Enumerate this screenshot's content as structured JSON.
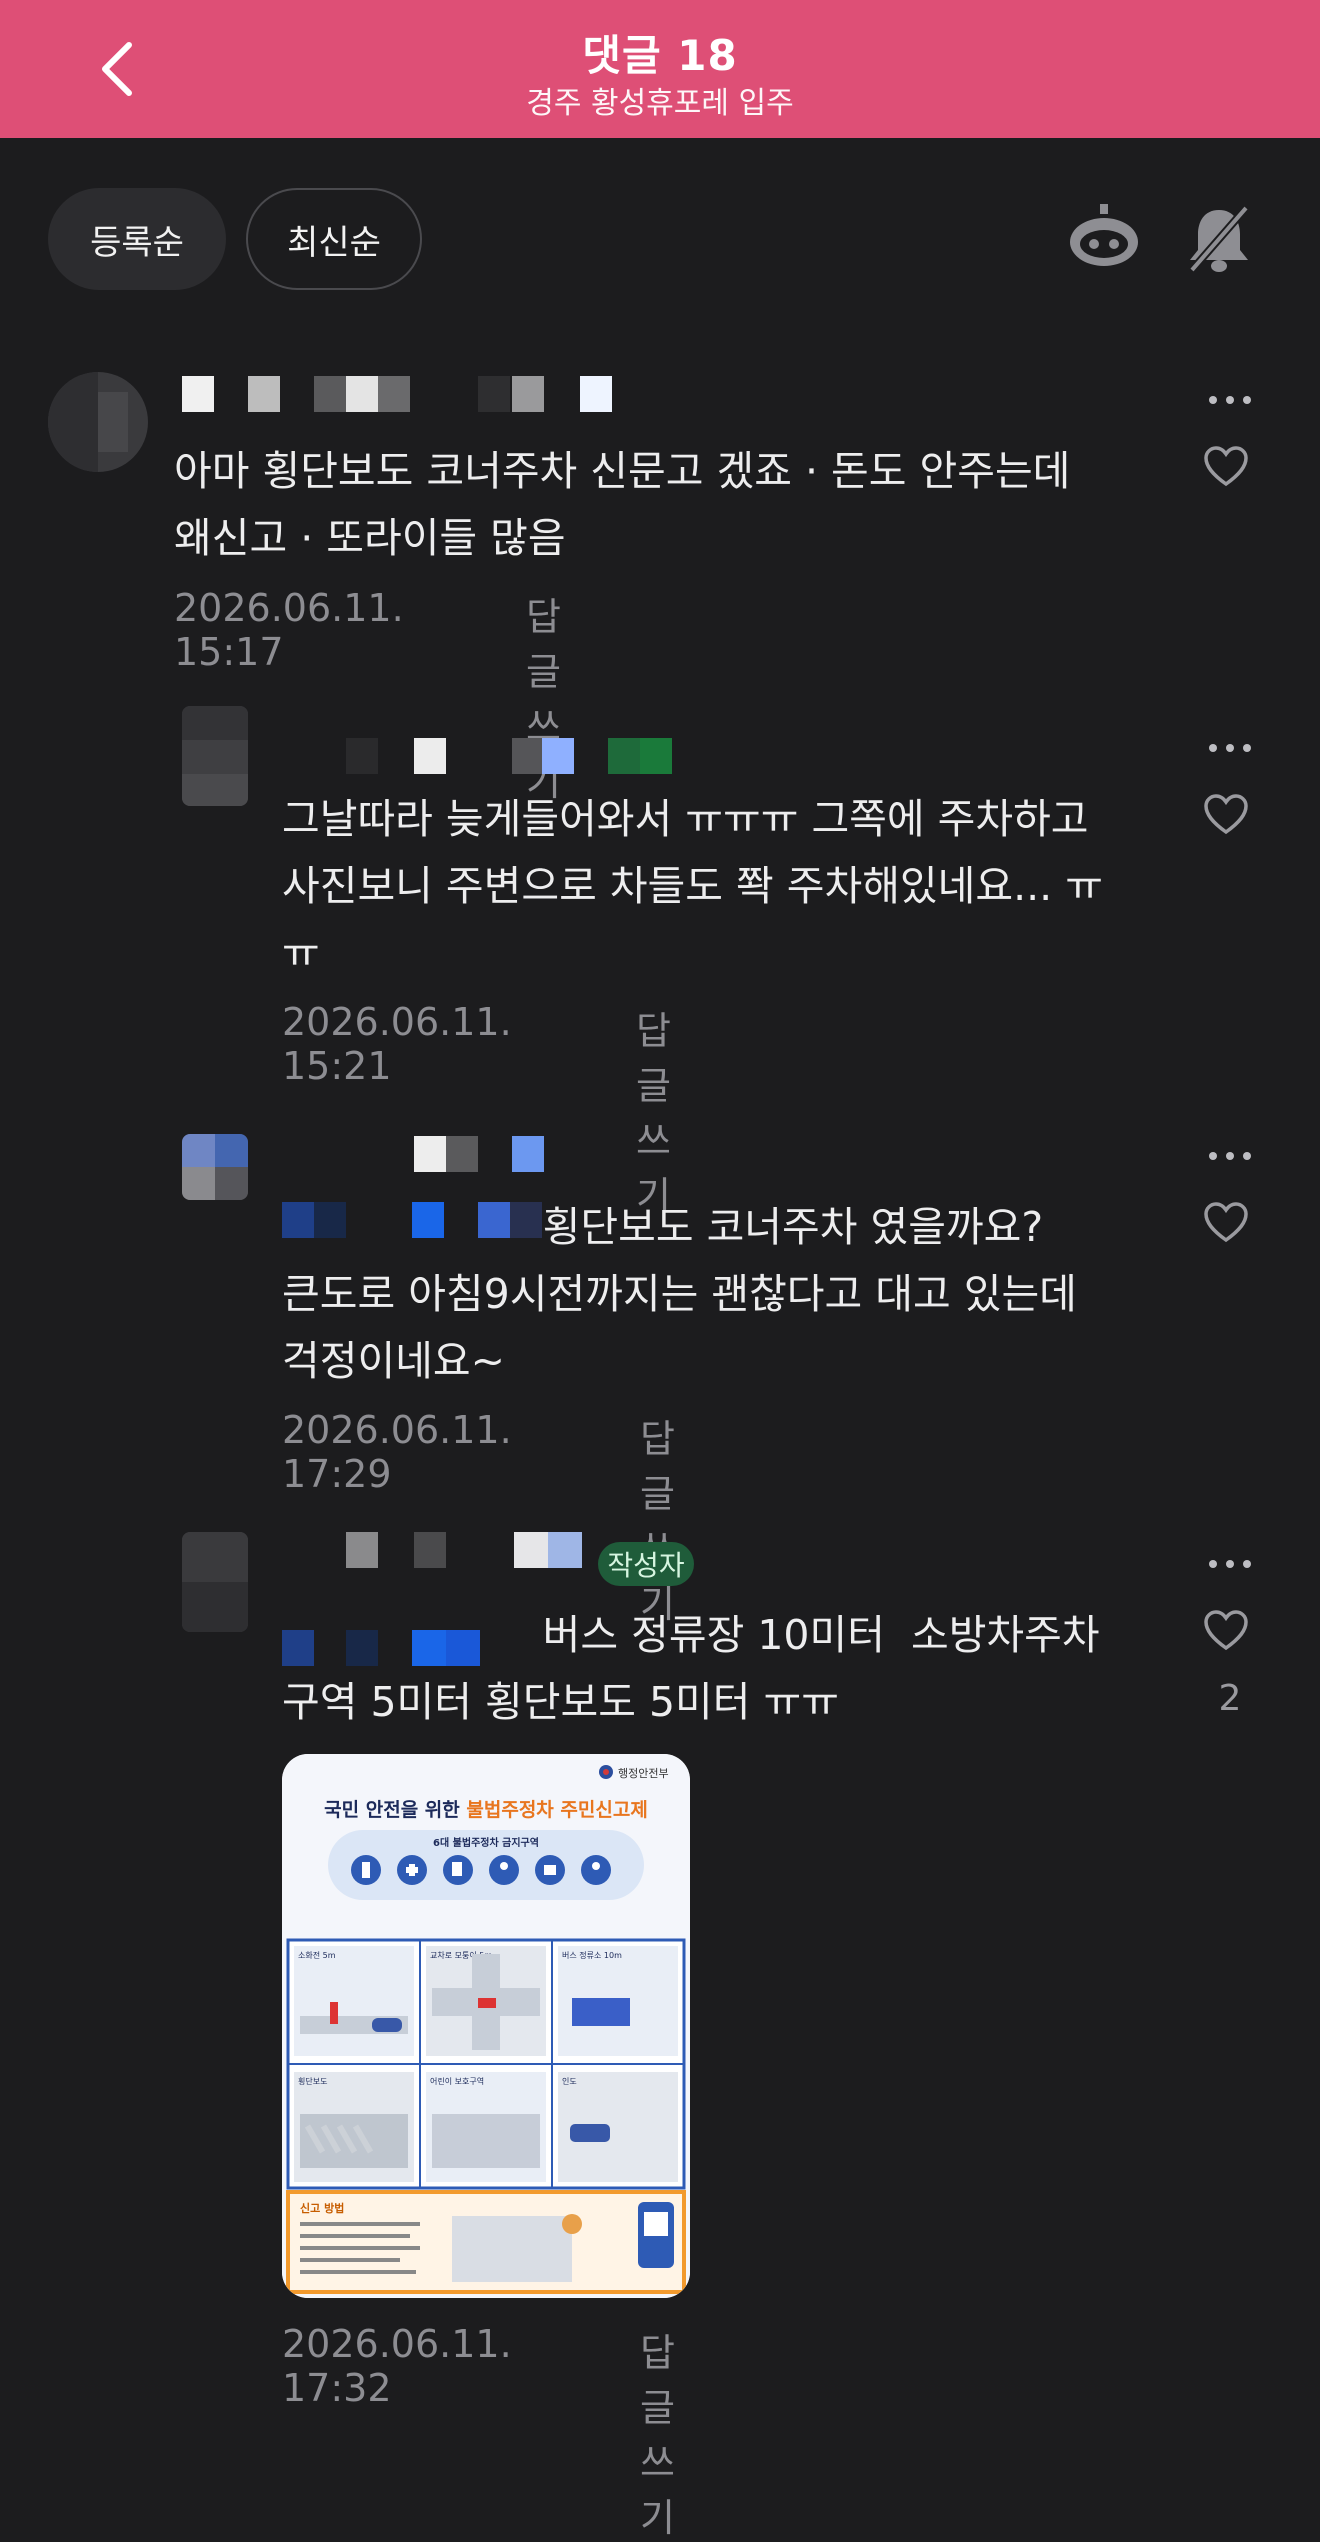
{
  "colors": {
    "accent": "#de4f76",
    "badge": "#1f5c3a"
  },
  "header": {
    "title": "댓글 18",
    "subtitle": "경주 황성휴포레 입주",
    "back_icon": "chevron-left-icon"
  },
  "sort": {
    "registered": "등록순",
    "latest": "최신순"
  },
  "toolbar": {
    "bot_icon": "robot-icon",
    "mute_icon": "bell-off-icon"
  },
  "comments": [
    {
      "text": "아마 횡단보도 코너주차 신문고 겠죠 · 돈도 안주는데\n왜신고 · 또라이들 많음",
      "time": "2026.06.11. 15:17",
      "reply": "답글 쓰기"
    },
    {
      "text": "그날따라 늦게들어와서 ㅠㅠㅠ 그쪽에 주차하고\n사진보니 주변으로 차들도 쫙 주차해있네요... ㅠ\nㅠ",
      "time": "2026.06.11. 15:21",
      "reply": "답글 쓰기"
    },
    {
      "text": "                    횡단보도 코너주차 였을까요?\n큰도로 아침9시전까지는 괜찮다고 대고 있는데\n걱정이네요~",
      "time": "2026.06.11. 17:29",
      "reply": "답글 쓰기"
    },
    {
      "text": "                    버스 정류장 10미터  소방차주차\n구역 5미터 횡단보도 5미터 ㅠㅠ",
      "time": "2026.06.11. 17:32",
      "reply": "답글 쓰기",
      "badge": "작성자",
      "likes": "2"
    }
  ],
  "poster": {
    "ministry": "행정안전부",
    "title_a": "국민 안전을 위한 ",
    "title_b": "불법주정차 주민신고제",
    "subtitle": "6대 불법주정차 금지구역",
    "zones": [
      "소화전 5m",
      "교차로 모퉁이 5m",
      "버스 정류소 10m",
      "횡단보도",
      "어린이 보호구역",
      "인도"
    ],
    "report_label": "신고 방법"
  }
}
